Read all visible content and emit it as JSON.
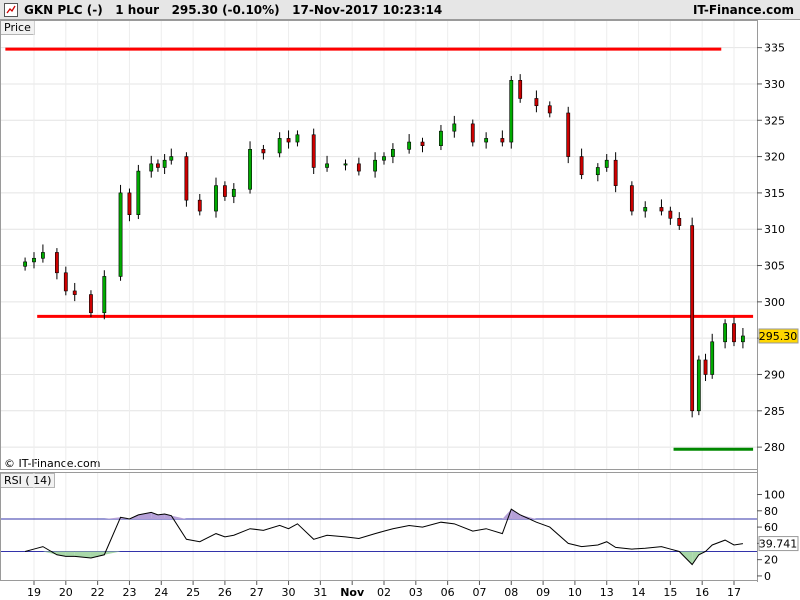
{
  "header": {
    "title": "GKN PLC (-)   1 hour   295.30 (-0.10%)   17-Nov-2017 10:23:14",
    "brand": "IT-Finance.com"
  },
  "panels": {
    "price_label": "Price",
    "rsi_label": "RSI ( 14)"
  },
  "copyright": "© IT-Finance.com",
  "colors": {
    "up": "#00aa00",
    "down": "#cc0000",
    "resistance": "#ff0000",
    "support": "#008800",
    "price_badge": "#ffd700",
    "rsi_fill_high": "#b5a0d8",
    "rsi_fill_low": "#a8d8a8"
  },
  "chart_data": [
    {
      "type": "candlestick",
      "name": "price",
      "x_tick_labels": [
        "19",
        "20",
        "22",
        "23",
        "24",
        "25",
        "26",
        "27",
        "30",
        "31",
        "Nov",
        "02",
        "03",
        "06",
        "07",
        "08",
        "09",
        "10",
        "13",
        "14",
        "15",
        "16",
        "17"
      ],
      "y_ticks": [
        280,
        285,
        290,
        295,
        300,
        305,
        310,
        315,
        320,
        325,
        330,
        335
      ],
      "ylim": [
        277.4,
        336.6
      ],
      "last_price": "295.30",
      "levels": [
        {
          "name": "resistance-top",
          "value": 334.8,
          "from_tick": "19",
          "to_tick": "16"
        },
        {
          "name": "resistance-mid",
          "value": 298.0,
          "from_tick": "20",
          "to_tick": "17"
        },
        {
          "name": "support-low",
          "value": 279.7,
          "from_tick": "16",
          "to_tick": "17"
        }
      ],
      "close_path": [
        [
          "19",
          305.5
        ],
        [
          "19",
          306
        ],
        [
          "19",
          306.8
        ],
        [
          "20",
          304
        ],
        [
          "20",
          301.5
        ],
        [
          "20",
          301
        ],
        [
          "22",
          298.5
        ],
        [
          "22",
          303.5
        ],
        [
          "23",
          315
        ],
        [
          "23",
          312
        ],
        [
          "23",
          318
        ],
        [
          "24",
          319
        ],
        [
          "24",
          318.5
        ],
        [
          "24",
          319.5
        ],
        [
          "24",
          320
        ],
        [
          "25",
          314
        ],
        [
          "25",
          312.5
        ],
        [
          "26",
          316
        ],
        [
          "26",
          314.5
        ],
        [
          "26",
          315.5
        ],
        [
          "27",
          321
        ],
        [
          "27",
          320.5
        ],
        [
          "30",
          322.5
        ],
        [
          "30",
          322
        ],
        [
          "30",
          323
        ],
        [
          "31",
          318.5
        ],
        [
          "31",
          319
        ],
        [
          "Nov",
          319
        ],
        [
          "Nov",
          318
        ],
        [
          "02",
          319.5
        ],
        [
          "02",
          320
        ],
        [
          "02",
          321
        ],
        [
          "03",
          322
        ],
        [
          "03",
          321.5
        ],
        [
          "06",
          323.5
        ],
        [
          "06",
          324.5
        ],
        [
          "07",
          322
        ],
        [
          "07",
          322.5
        ],
        [
          "08",
          322
        ],
        [
          "08",
          330.5
        ],
        [
          "08",
          328
        ],
        [
          "09",
          327
        ],
        [
          "09",
          326
        ],
        [
          "10",
          320
        ],
        [
          "10",
          317.5
        ],
        [
          "13",
          318.5
        ],
        [
          "13",
          319.5
        ],
        [
          "13",
          316
        ],
        [
          "14",
          312.5
        ],
        [
          "14",
          313
        ],
        [
          "15",
          312.5
        ],
        [
          "15",
          311.5
        ],
        [
          "15",
          310.5
        ],
        [
          "16",
          285
        ],
        [
          "16",
          292
        ],
        [
          "16",
          290
        ],
        [
          "16",
          294.5
        ],
        [
          "17",
          297
        ],
        [
          "17",
          294.5
        ],
        [
          "17",
          295.3
        ]
      ]
    },
    {
      "type": "line",
      "name": "RSI ( 14)",
      "y_ticks": [
        0,
        20,
        40,
        60,
        80,
        100
      ],
      "ylim": [
        -5,
        108
      ],
      "reference_lines": [
        70,
        30
      ],
      "last_value": "39.741",
      "values_by_tick": [
        [
          "19",
          30
        ],
        [
          "19",
          33
        ],
        [
          "19",
          36
        ],
        [
          "20",
          26
        ],
        [
          "20",
          24
        ],
        [
          "20",
          24
        ],
        [
          "22",
          22
        ],
        [
          "22",
          26
        ],
        [
          "23",
          72
        ],
        [
          "23",
          70
        ],
        [
          "23",
          75
        ],
        [
          "24",
          78
        ],
        [
          "24",
          75
        ],
        [
          "24",
          76
        ],
        [
          "24",
          74
        ],
        [
          "25",
          45
        ],
        [
          "25",
          42
        ],
        [
          "26",
          52
        ],
        [
          "26",
          48
        ],
        [
          "26",
          50
        ],
        [
          "27",
          58
        ],
        [
          "27",
          56
        ],
        [
          "30",
          62
        ],
        [
          "30",
          58
        ],
        [
          "30",
          64
        ],
        [
          "31",
          45
        ],
        [
          "31",
          50
        ],
        [
          "Nov",
          48
        ],
        [
          "Nov",
          46
        ],
        [
          "02",
          52
        ],
        [
          "02",
          55
        ],
        [
          "02",
          58
        ],
        [
          "03",
          62
        ],
        [
          "03",
          60
        ],
        [
          "06",
          66
        ],
        [
          "06",
          64
        ],
        [
          "07",
          55
        ],
        [
          "07",
          58
        ],
        [
          "08",
          52
        ],
        [
          "08",
          82
        ],
        [
          "08",
          75
        ],
        [
          "09",
          66
        ],
        [
          "09",
          60
        ],
        [
          "10",
          40
        ],
        [
          "10",
          36
        ],
        [
          "13",
          38
        ],
        [
          "13",
          42
        ],
        [
          "13",
          35
        ],
        [
          "14",
          33
        ],
        [
          "14",
          34
        ],
        [
          "15",
          36
        ],
        [
          "15",
          33
        ],
        [
          "15",
          30
        ],
        [
          "16",
          14
        ],
        [
          "16",
          26
        ],
        [
          "16",
          30
        ],
        [
          "16",
          38
        ],
        [
          "17",
          44
        ],
        [
          "17",
          38
        ],
        [
          "17",
          39.741
        ]
      ]
    }
  ]
}
